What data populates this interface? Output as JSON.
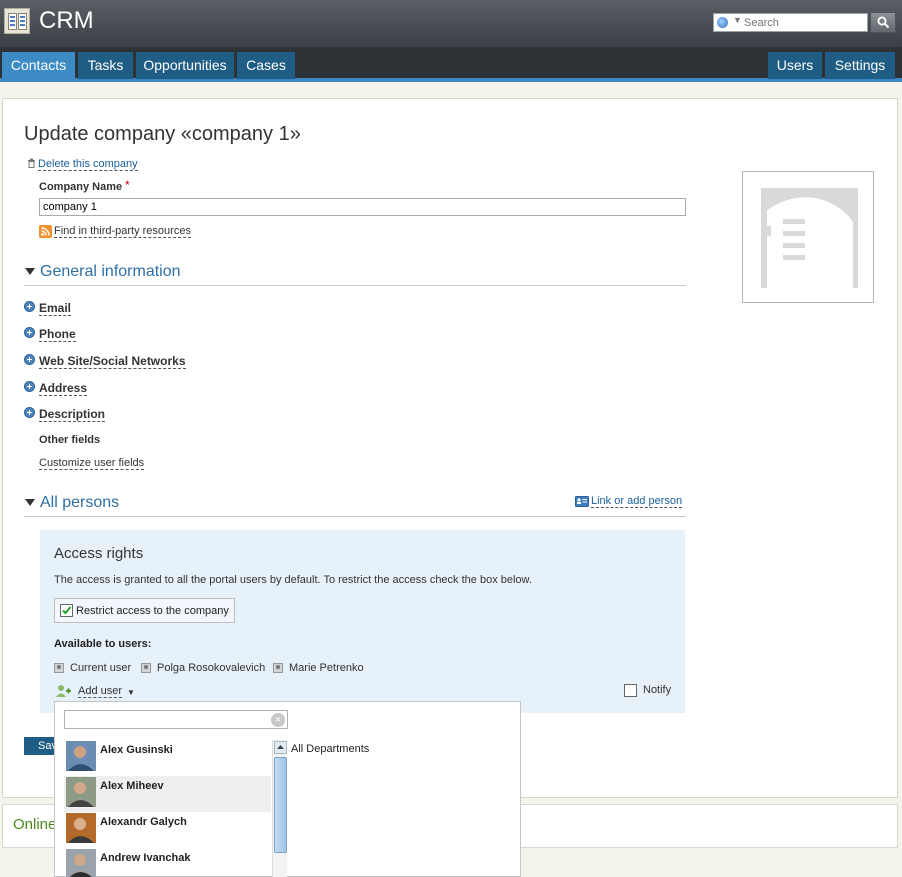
{
  "app": {
    "title": "CRM"
  },
  "search": {
    "placeholder": "Search"
  },
  "nav": {
    "tabs": [
      {
        "label": "Contacts"
      },
      {
        "label": "Tasks"
      },
      {
        "label": "Opportunities"
      },
      {
        "label": "Cases"
      }
    ],
    "right": [
      {
        "label": "Users"
      },
      {
        "label": "Settings"
      }
    ]
  },
  "page": {
    "title": "Update company «company 1»",
    "delete_link": "Delete this company",
    "company_name_label": "Company Name",
    "required_mark": "*",
    "company_name_value": "company 1",
    "find_link": "Find in third-party resources"
  },
  "general": {
    "title": "General information",
    "fields": [
      {
        "label": "Email"
      },
      {
        "label": "Phone"
      },
      {
        "label": "Web Site/Social Networks"
      },
      {
        "label": "Address"
      },
      {
        "label": "Description"
      }
    ],
    "other_fields": "Other fields",
    "customize_link": "Customize user fields"
  },
  "persons": {
    "title": "All persons",
    "link_add": "Link or add person"
  },
  "access": {
    "title": "Access rights",
    "note": "The access is granted to all the portal users by default. To restrict the access check the box below.",
    "restrict_label": "Restrict access to the company",
    "restrict_checked": true,
    "available_label": "Available to users:",
    "users": [
      {
        "name": "Current user"
      },
      {
        "name": "Polga Rosokovalevich"
      },
      {
        "name": "Marie Petrenko"
      }
    ],
    "add_user": "Add user",
    "notify_label": "Notify"
  },
  "dropdown": {
    "search_value": "",
    "department": "All Departments",
    "people": [
      {
        "name": "Alex Gusinski"
      },
      {
        "name": "Alex Miheev"
      },
      {
        "name": "Alexandr Galych"
      },
      {
        "name": "Andrew Ivanchak"
      }
    ]
  },
  "footer": {
    "save_label": "Save",
    "online_label": "Online"
  }
}
